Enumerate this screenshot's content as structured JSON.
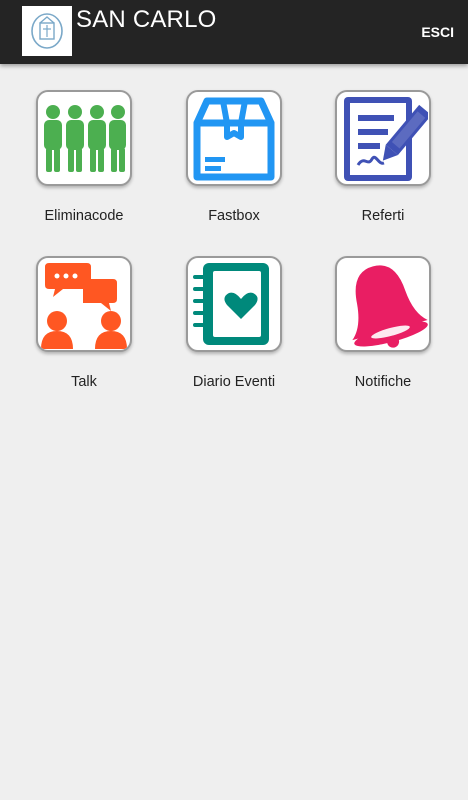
{
  "header": {
    "title": "SAN CARLO",
    "exit_label": "ESCI",
    "background": "#242424"
  },
  "tiles": [
    {
      "label": "Eliminacode",
      "icon": "people-queue-icon",
      "color": "#4caf50"
    },
    {
      "label": "Fastbox",
      "icon": "box-icon",
      "color": "#2196f3"
    },
    {
      "label": "Referti",
      "icon": "document-sign-icon",
      "color": "#3f51b5"
    },
    {
      "label": "Talk",
      "icon": "chat-people-icon",
      "color": "#ff5722"
    },
    {
      "label": "Diario Eventi",
      "icon": "diary-heart-icon",
      "color": "#00897b"
    },
    {
      "label": "Notifiche",
      "icon": "bell-icon",
      "color": "#e91e63"
    }
  ]
}
